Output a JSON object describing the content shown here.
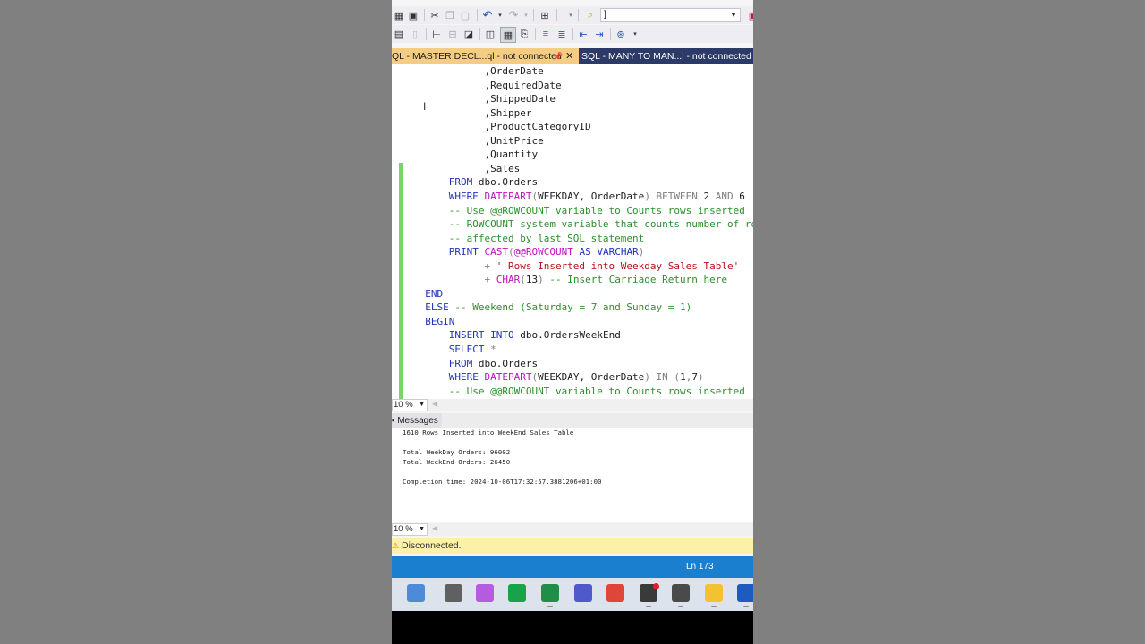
{
  "toolbar": {
    "dropdown_value": "]"
  },
  "tabs": {
    "active_label": "QL - MASTER DECL...ql - not connected",
    "inactive_label": "SQL - MANY TO MAN...l - not connected"
  },
  "editor": {
    "lines": [
      [
        {
          "t": "            ,OrderDate",
          "c": ""
        }
      ],
      [
        {
          "t": "            ,RequiredDate",
          "c": ""
        }
      ],
      [
        {
          "t": "            ,ShippedDate",
          "c": ""
        }
      ],
      [
        {
          "t": "            ,Shipper",
          "c": ""
        }
      ],
      [
        {
          "t": "            ,ProductCategoryID",
          "c": ""
        }
      ],
      [
        {
          "t": "            ,UnitPrice",
          "c": ""
        }
      ],
      [
        {
          "t": "            ,Quantity",
          "c": ""
        }
      ],
      [
        {
          "t": "            ,Sales",
          "c": ""
        }
      ],
      [
        {
          "t": "      FROM",
          "c": "kw"
        },
        {
          "t": " dbo.Orders",
          "c": ""
        }
      ],
      [
        {
          "t": "      WHERE",
          "c": "kw"
        },
        {
          "t": " ",
          "c": ""
        },
        {
          "t": "DATEPART",
          "c": "fn"
        },
        {
          "t": "(",
          "c": "gr"
        },
        {
          "t": "WEEKDAY",
          "c": ""
        },
        {
          "t": ", OrderDate",
          "c": ""
        },
        {
          "t": ")",
          "c": "gr"
        },
        {
          "t": " BETWEEN",
          "c": "gr"
        },
        {
          "t": " 2",
          "c": ""
        },
        {
          "t": " AND",
          "c": "gr"
        },
        {
          "t": " 6",
          "c": ""
        }
      ],
      [
        {
          "t": "      -- Use @@ROWCOUNT variable to Counts rows inserted",
          "c": "cm"
        }
      ],
      [
        {
          "t": "      -- ROWCOUNT system variable that counts number of rows",
          "c": "cm"
        }
      ],
      [
        {
          "t": "      -- affected by last SQL statement",
          "c": "cm"
        }
      ],
      [
        {
          "t": "      PRINT",
          "c": "kw"
        },
        {
          "t": " ",
          "c": ""
        },
        {
          "t": "CAST",
          "c": "fn"
        },
        {
          "t": "(",
          "c": "gr"
        },
        {
          "t": "@@ROWCOUNT",
          "c": "fn"
        },
        {
          "t": " AS",
          "c": "kw"
        },
        {
          "t": " VARCHAR",
          "c": "kw"
        },
        {
          "t": ")",
          "c": "gr"
        }
      ],
      [
        {
          "t": "            +",
          "c": "gr"
        },
        {
          "t": " ' Rows Inserted into Weekday Sales Table'",
          "c": "st"
        }
      ],
      [
        {
          "t": "            +",
          "c": "gr"
        },
        {
          "t": " ",
          "c": ""
        },
        {
          "t": "CHAR",
          "c": "fn"
        },
        {
          "t": "(",
          "c": "gr"
        },
        {
          "t": "13",
          "c": ""
        },
        {
          "t": ")",
          "c": "gr"
        },
        {
          "t": " -- Insert Carriage Return here",
          "c": "cm"
        }
      ],
      [
        {
          "t": "  END",
          "c": "kw"
        }
      ],
      [
        {
          "t": "  ELSE",
          "c": "kw"
        },
        {
          "t": " -- Weekend (Saturday = 7 and Sunday = 1)",
          "c": "cm"
        }
      ],
      [
        {
          "t": "  BEGIN",
          "c": "kw"
        }
      ],
      [
        {
          "t": "      INSERT",
          "c": "kw"
        },
        {
          "t": " INTO",
          "c": "kw"
        },
        {
          "t": " dbo.OrdersWeekEnd",
          "c": ""
        }
      ],
      [
        {
          "t": "      SELECT",
          "c": "kw"
        },
        {
          "t": " *",
          "c": "gr"
        }
      ],
      [
        {
          "t": "      FROM",
          "c": "kw"
        },
        {
          "t": " dbo.Orders",
          "c": ""
        }
      ],
      [
        {
          "t": "      WHERE",
          "c": "kw"
        },
        {
          "t": " ",
          "c": ""
        },
        {
          "t": "DATEPART",
          "c": "fn"
        },
        {
          "t": "(",
          "c": "gr"
        },
        {
          "t": "WEEKDAY",
          "c": ""
        },
        {
          "t": ", OrderDate",
          "c": ""
        },
        {
          "t": ")",
          "c": "gr"
        },
        {
          "t": " IN",
          "c": "gr"
        },
        {
          "t": " (",
          "c": "gr"
        },
        {
          "t": "1",
          "c": ""
        },
        {
          "t": ",",
          "c": "gr"
        },
        {
          "t": "7",
          "c": ""
        },
        {
          "t": ")",
          "c": "gr"
        }
      ],
      [
        {
          "t": "      -- Use @@ROWCOUNT variable to Counts rows inserted",
          "c": "cm"
        }
      ]
    ],
    "zoom": "10 %"
  },
  "messages": {
    "tab_label": "Messages",
    "lines": [
      "1610 Rows Inserted into WeekEnd Sales Table",
      "",
      "Total WeekDay Orders: 96002",
      "Total WeekEnd Orders: 26450",
      "",
      "Completion time: 2024-10-06T17:32:57.3881206+01:00"
    ],
    "zoom": "10 %"
  },
  "connection": {
    "status": "Disconnected."
  },
  "statusbar": {
    "line": "Ln 173"
  },
  "taskbar": {
    "apps": [
      {
        "name": "start-apps",
        "color": "#4d8ad8"
      },
      {
        "name": "task-view",
        "color": "#606060"
      },
      {
        "name": "copilot",
        "color": "#b35ce0"
      },
      {
        "name": "qlik",
        "color": "#16a34a"
      },
      {
        "name": "spreadsheet-app",
        "color": "#1f8f47"
      },
      {
        "name": "teams",
        "color": "#5059c9"
      },
      {
        "name": "chrome",
        "color": "#e0453a"
      },
      {
        "name": "obs",
        "color": "#3a3a3a"
      },
      {
        "name": "calculator",
        "color": "#4a4a4a"
      },
      {
        "name": "file-explorer",
        "color": "#f2c230"
      },
      {
        "name": "word",
        "color": "#1e5bbf"
      }
    ]
  }
}
